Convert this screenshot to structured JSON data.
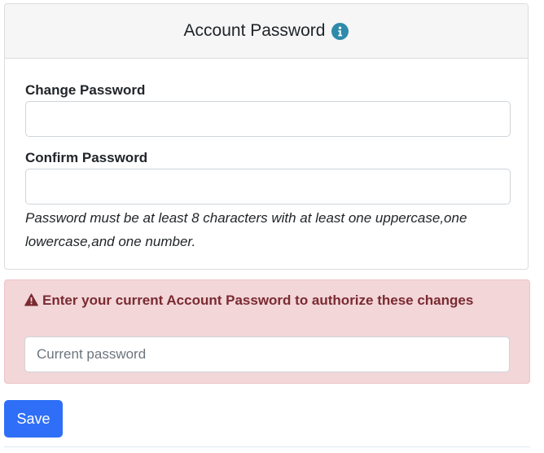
{
  "card": {
    "title": "Account Password",
    "info_icon": "info-icon"
  },
  "change_password": {
    "label": "Change Password",
    "value": "",
    "placeholder": ""
  },
  "confirm_password": {
    "label": "Confirm Password",
    "value": "",
    "placeholder": ""
  },
  "help_text": "Password must be at least 8 characters with at least one uppercase,one lowercase,and one number.",
  "alert": {
    "icon": "warning-icon",
    "message": "Enter your current Account Password to authorize these changes",
    "current_password": {
      "value": "",
      "placeholder": "Current password"
    },
    "background_color": "#f2d6d8",
    "text_color": "#7a2a31"
  },
  "actions": {
    "save_label": "Save",
    "primary_color": "#2f6ff7"
  }
}
